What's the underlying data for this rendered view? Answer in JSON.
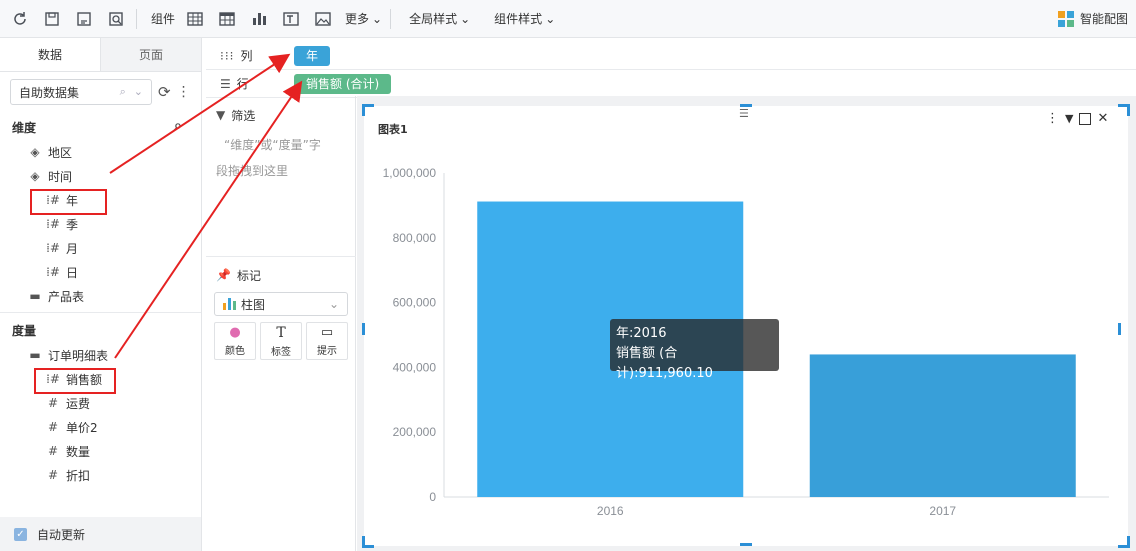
{
  "toolbar": {
    "component_label": "组件",
    "more_label": "更多",
    "global_style_label": "全局样式",
    "component_style_label": "组件样式",
    "smart_chart_label": "智能配图"
  },
  "left_panel": {
    "tabs": [
      {
        "label": "数据"
      },
      {
        "label": "页面"
      }
    ],
    "dataset": "自助数据集",
    "dimension_title": "维度",
    "dimensions": {
      "region": "地区",
      "time": "时间",
      "time_children": [
        "年",
        "季",
        "月",
        "日"
      ],
      "product": "产品表"
    },
    "measure_title": "度量",
    "measures": {
      "table": "订单明细表",
      "fields": [
        "销售额",
        "运费",
        "单价2",
        "数量",
        "折扣"
      ]
    },
    "auto_update": "自动更新"
  },
  "shelves": {
    "column_label": "列",
    "column_pill": "年",
    "row_label": "行",
    "row_pill": "销售额 (合计)"
  },
  "config": {
    "filter_label": "筛选",
    "filter_hint_line1": "“维度”或“度量”字",
    "filter_hint_line2": "段拖拽到这里",
    "mark_label": "标记",
    "mark_type": "柱图",
    "mark_buttons": [
      {
        "label": "颜色"
      },
      {
        "label": "标签"
      },
      {
        "label": "提示"
      }
    ]
  },
  "chart_data": {
    "type": "bar",
    "title": "图表1",
    "categories": [
      "2016",
      "2017"
    ],
    "values": [
      911960.1,
      440000
    ],
    "ylim": [
      0,
      1000000
    ],
    "yticks": [
      "1,000,000",
      "800,000",
      "600,000",
      "400,000",
      "200,000",
      "0"
    ],
    "grid": false,
    "colors": [
      "#3daeed",
      "#389fd9"
    ],
    "tooltip": {
      "line1": "年:2016",
      "line2": "销售额 (合计):911,960.10"
    }
  },
  "colors": {
    "accent_blue": "#3aa3d8",
    "pill_green": "#5cb98a",
    "annotation_red": "#e52222"
  }
}
